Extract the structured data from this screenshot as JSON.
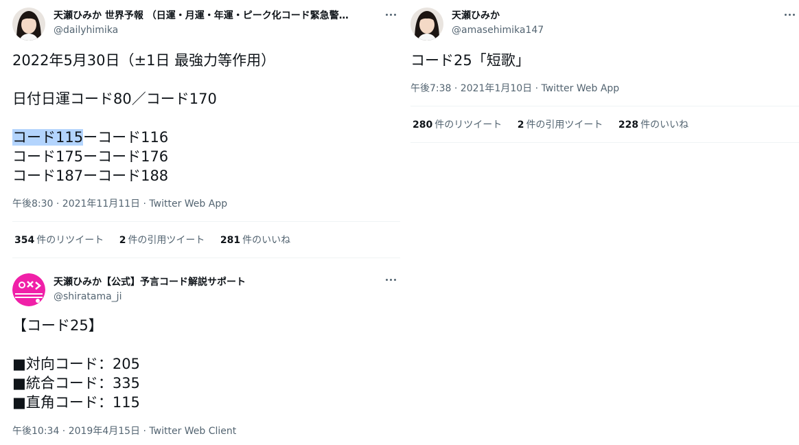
{
  "tweets": [
    {
      "name": "天瀬ひみか 世界予報 （日運・月運・年運・ピーク化コード緊急警…",
      "handle": "@dailyhimika",
      "avatar": "girl-portrait",
      "lines": [
        "2022年5月30日（±1日 最強力等作用）",
        "",
        "日付日運コード80／コード170",
        "",
        "コード115",
        "コード175ーコード176",
        "コード187ーコード188"
      ],
      "highlight_rest": "ーコード116",
      "meta": "午後8:30 · 2021年11月11日 · Twitter Web App",
      "stats": {
        "retweets_count": "354",
        "retweets_label": "件のリツイート",
        "quotes_count": "2",
        "quotes_label": "件の引用ツイート",
        "likes_count": "281",
        "likes_label": "件のいいね"
      }
    },
    {
      "name": "天瀬ひみか【公式】予言コード解説サポート",
      "handle": "@shiratama_ji",
      "avatar": "pink-logo",
      "lines": [
        "【コード25】",
        "",
        "■対向コード：205",
        "■統合コード：335",
        "■直角コード：115"
      ],
      "meta": "午後10:34 · 2019年4月15日 · Twitter Web Client"
    },
    {
      "name": "天瀬ひみか",
      "handle": "@amasehimika147",
      "avatar": "girl-portrait",
      "lines": [
        "コード25「短歌」"
      ],
      "meta": "午後7:38 · 2021年1月10日 · Twitter Web App",
      "stats": {
        "retweets_count": "280",
        "retweets_label": "件のリツイート",
        "quotes_count": "2",
        "quotes_label": "件の引用ツイート",
        "likes_count": "228",
        "likes_label": "件のいいね"
      }
    }
  ],
  "colors": {
    "text": "#0f1419",
    "secondary": "#536471",
    "divider": "#eff3f4",
    "highlight": "#b3d4fd",
    "logo": "#f020a8"
  }
}
